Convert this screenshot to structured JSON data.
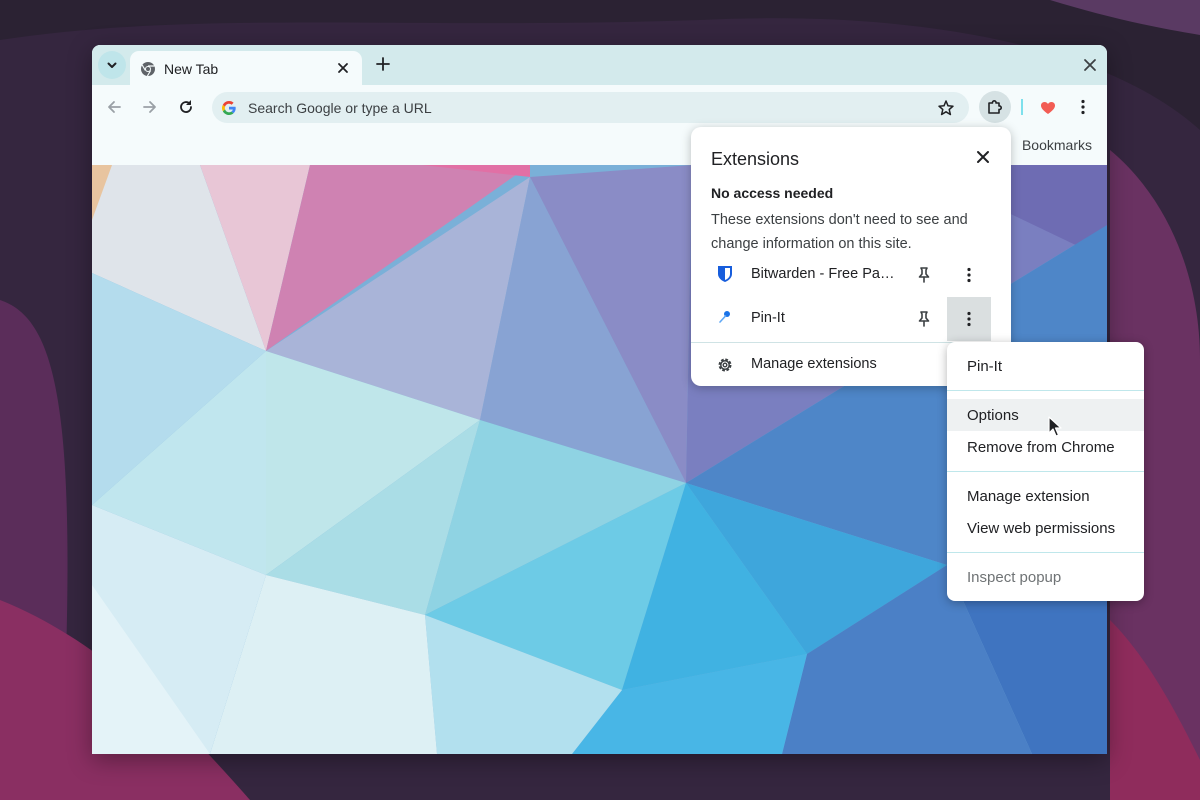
{
  "tab": {
    "title": "New Tab"
  },
  "omnibox": {
    "placeholder": "Search Google or type a URL"
  },
  "bookmarks": {
    "label": "Bookmarks"
  },
  "extensions_popup": {
    "title": "Extensions",
    "section_title": "No access needed",
    "section_desc": "These extensions don't need to see and change information on this site.",
    "items": [
      {
        "name": "Bitwarden - Free Password Manager",
        "icon": "bitwarden-icon"
      },
      {
        "name": "Pin-It",
        "icon": "pin-it-icon"
      }
    ],
    "manage_label": "Manage extensions"
  },
  "context_menu": {
    "header": "Pin-It",
    "items": {
      "options": "Options",
      "remove": "Remove from Chrome",
      "manage": "Manage extension",
      "permissions": "View web permissions",
      "inspect": "Inspect popup"
    }
  },
  "colors": {
    "tabstrip": "#d3eaec",
    "toolbar": "#f5fbfc",
    "accent": "#7ee0ec"
  }
}
